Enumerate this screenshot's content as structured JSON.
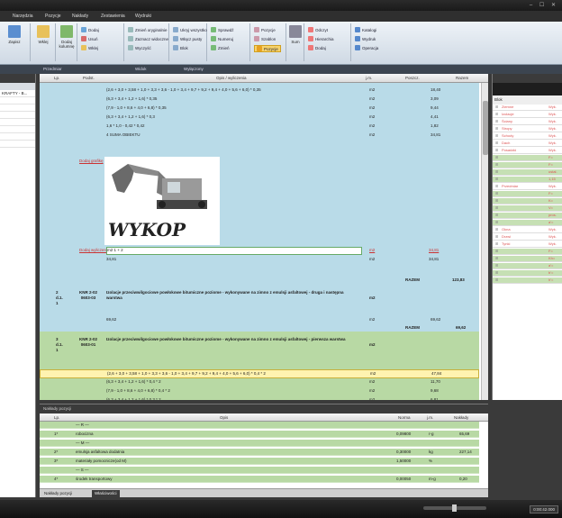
{
  "menu": [
    "Narzędzia",
    "Pozycje",
    "Nakłady",
    "Zestawienia",
    "Wydruki"
  ],
  "ribbon": {
    "big_buttons": [
      "Zapisz",
      "Wklej",
      "Dodaj kolumnę"
    ],
    "small_buttons": [
      "Dodaj",
      "Usuń",
      "Wklej",
      "Zmień oryginalnie",
      "Zaznacz widoczne",
      "Wyczyść",
      "Ukryj wszystko",
      "Włącz pusty",
      "Blok",
      "Podziel",
      "Kopiuj",
      "Przenieś",
      "Pozycje",
      "Sprawdź",
      "Numeruj",
      "Zmień",
      "Zmień cytację",
      "Ustaw kolejność",
      "Sum",
      "Pozycje",
      "Szablon",
      "Odczyt",
      "Hierarchia",
      "Dodaj",
      "Nakłady",
      "Katalogi",
      "Wydruk",
      "Operacja"
    ],
    "active_button": "Pozycje"
  },
  "strip_tabs": [
    "Przedmiar",
    "Widok",
    "Wyłączony"
  ],
  "left_panel": {
    "rows": [
      "KRAFTY - B...",
      "",
      "",
      "",
      "",
      "",
      "",
      "",
      ""
    ]
  },
  "grid": {
    "columns": [
      "Lp.",
      "Podst.",
      "Opis / wyliczenia",
      "j.m.",
      "Poszcz.",
      "Razem"
    ],
    "rows": [
      {
        "style": "blue",
        "desc": "(2,6 + 3,0 + 3,58 + 1,0 + 3,3 + 3,6 - 1,0 + 3,4 + 9,7 + 9,2 + 9,4 + 4,0 + 5,6 + 6,0) * 0,35",
        "unit": "m2",
        "val": "18,40"
      },
      {
        "style": "blue",
        "desc": "(6,3 + 3,4 + 1,2 + 1,6) * 0,35",
        "unit": "m2",
        "val": "3,09"
      },
      {
        "style": "blue",
        "desc": "(7,9 - 1,0 + 8,6 + 4,0 + 6,8) * 0,35",
        "unit": "m2",
        "val": "9,44"
      },
      {
        "style": "blue",
        "desc": "(6,3 + 3,4 + 1,2 + 1,6) * 0,3",
        "unit": "m2",
        "val": "4,41"
      },
      {
        "style": "blue",
        "desc": "1,6 * 1,0 - 0,42 * 0,42",
        "unit": "m2",
        "val": "1,82"
      },
      {
        "style": "blue",
        "desc": "4 SUMA OBIEKTU",
        "unit": "m2",
        "val": "34,81"
      }
    ],
    "image_label": "Dodaj grafikę",
    "image_text": "WYKOP",
    "after_image": [
      {
        "style": "blue",
        "podst": "Dodaj wyliczenie",
        "desc": "m2 1 + 2",
        "unit": "m2",
        "val": "34,81"
      },
      {
        "style": "blue",
        "desc": "34,81",
        "unit": "m2",
        "val": "34,81"
      }
    ],
    "razem_label": "RAZEM",
    "razem_value": "123,83",
    "item1": {
      "lp": "2 d.1. 1",
      "knr": "KNR 2-02 0603-03",
      "desc": "Izolacje przeciwwilgociowe powłokowe bitumiczne poziome - wykonywane na zimno z emulsji asfaltowej - druga i następna warstwa",
      "unit": "m2",
      "qty": "69,62",
      "qty_total": "69,62"
    },
    "item2": {
      "lp": "3 d.1. 1",
      "knr": "KNR 2-02 0603-01",
      "desc": "Izolacje przeciwwilgociowe powłokowe bitumiczne poziome - wykonywane na zimno z emulsji asfaltowej - pierwsza warstwa",
      "unit": "m2",
      "qty": "69,62"
    },
    "green_rows": [
      {
        "style": "yellow",
        "desc": "(2,6 + 3,0 + 3,58 + 1,0 + 3,3 + 3,6 - 1,0 + 3,4 + 9,7 + 9,2 + 9,4 + 4,0 + 5,6 + 6,0) * 0,4 * 2",
        "unit": "m2",
        "val": "47,84"
      },
      {
        "style": "green",
        "desc": "(6,3 + 3,4 + 1,2 + 1,6) * 0,4 * 2",
        "unit": "m2",
        "val": "11,70"
      },
      {
        "style": "green",
        "desc": "(7,9 - 1,0 + 8,6 + 4,0 + 6,8) * 0,4 * 2",
        "unit": "m2",
        "val": "9,68"
      },
      {
        "style": "green",
        "desc": "(6,3 + 3,4 + 1,2 + 1,6) * 0,3 * 2",
        "unit": "m2",
        "val": "6,81"
      }
    ]
  },
  "right_panel": {
    "label": "Blok",
    "rows": [
      {
        "c1": "Ziemne",
        "c2": "Wyk."
      },
      {
        "c1": "Izolacje",
        "c2": "Wyk."
      },
      {
        "c1": "Ściany",
        "c2": "Wyk."
      },
      {
        "c1": "Stropy",
        "c2": "Wyk."
      },
      {
        "c1": "Schody",
        "c2": "Wyk."
      },
      {
        "c1": "Dach",
        "c2": "Wyk."
      },
      {
        "c1": "Posadzki",
        "c2": "Wyk."
      },
      {
        "c1": "",
        "c2": "F="
      },
      {
        "c1": "",
        "c2": "F="
      },
      {
        "c1": "",
        "c2": "ustal."
      },
      {
        "c1": "",
        "c2": "1,15"
      },
      {
        "c1": "Przedmiar",
        "c2": "Wyk."
      },
      {
        "c1": "",
        "c2": "F="
      },
      {
        "c1": "",
        "c2": "K="
      },
      {
        "c1": "",
        "c2": "V="
      },
      {
        "c1": "",
        "c2": "pros."
      },
      {
        "c1": "",
        "c2": "a'="
      },
      {
        "c1": "Okna",
        "c2": "Wyk."
      },
      {
        "c1": "Drzwi",
        "c2": "Wyk."
      },
      {
        "c1": "Tynki",
        "c2": "Wyk."
      },
      {
        "c1": "",
        "c2": "F="
      },
      {
        "c1": "",
        "c2": "Kh="
      },
      {
        "c1": "",
        "c2": "a'="
      },
      {
        "c1": "",
        "c2": "b'="
      },
      {
        "c1": "",
        "c2": "h'="
      }
    ]
  },
  "bottom": {
    "title": "Nakłady pozycji",
    "columns": [
      "Lp.",
      "Opis",
      "Norma",
      "j.m.",
      "Nakłady"
    ],
    "rows": [
      {
        "lp": "",
        "desc": "— R —",
        "norm": "",
        "unit": "",
        "val": ""
      },
      {
        "lp": "1*",
        "desc": "robocizna",
        "norm": "0,09800",
        "unit": "r-g",
        "val": "65,69"
      },
      {
        "lp": "",
        "desc": "— M —",
        "norm": "",
        "unit": "",
        "val": ""
      },
      {
        "lp": "2*",
        "desc": "emulsja asfaltowa dodatnia",
        "norm": "0,30000",
        "unit": "kg",
        "val": "227,14"
      },
      {
        "lp": "3*",
        "desc": "materiały pomocnicze(od M)",
        "norm": "1,50000",
        "unit": "%",
        "val": ""
      },
      {
        "lp": "",
        "desc": "— S —",
        "norm": "",
        "unit": "",
        "val": ""
      },
      {
        "lp": "4*",
        "desc": "środek transportowy",
        "norm": "0,00050",
        "unit": "m-g",
        "val": "0,20"
      }
    ],
    "tabs": [
      "Nakłady pozycji",
      "Właściwości"
    ]
  },
  "status": {
    "task": "0:00:42.000"
  }
}
